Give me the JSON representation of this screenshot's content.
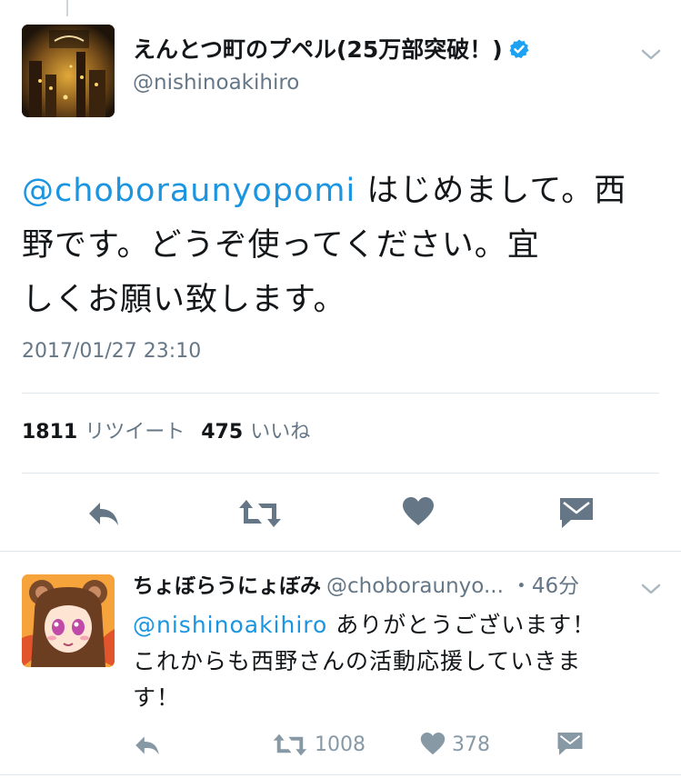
{
  "tweet": {
    "display_name": "えんとつ町のプペル(25万部突破！)",
    "handle": "@nishinoakihiro",
    "text_mention": "@choboraunyopomi",
    "text_line1_rest": " はじめまして。西",
    "text_line2": "野です。どうぞ使ってください。宜",
    "text_line3": "しくお願い致します。",
    "timestamp": "2017/01/27 23:10",
    "retweet_count": "1811",
    "retweet_label": "リツイート",
    "like_count": "475",
    "like_label": "いいね"
  },
  "reply": {
    "display_name": "ちょぼらうにょぽみ",
    "handle": "@choboraunyo...",
    "time": "・46分",
    "mention": "@nishinoakihiro",
    "text_line1_rest": " ありがとうございます！",
    "text_line2": "これからも西野さんの活動応援していきま",
    "text_line3": "す！",
    "retweet_count": "1008",
    "like_count": "378"
  },
  "icons": [
    "reply-icon",
    "retweet-icon",
    "heart-icon",
    "message-icon",
    "verified-icon",
    "chevron-down-icon"
  ],
  "colors": {
    "link": "#1b95e0",
    "verified": "#1da1f2",
    "secondary": "#657786",
    "icon": "#8899a6",
    "icon_dark": "#657786"
  }
}
